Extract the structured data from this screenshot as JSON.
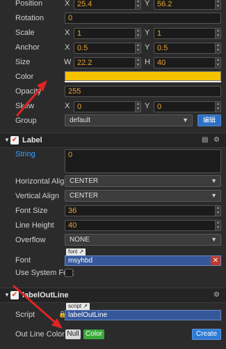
{
  "node": {
    "position": {
      "label": "Position",
      "x_axis": "X",
      "x": "25.4",
      "y_axis": "Y",
      "y": "56.2"
    },
    "rotation": {
      "label": "Rotation",
      "value": "0"
    },
    "scale": {
      "label": "Scale",
      "x_axis": "X",
      "x": "1",
      "y_axis": "Y",
      "y": "1"
    },
    "anchor": {
      "label": "Anchor",
      "x_axis": "X",
      "x": "0.5",
      "y_axis": "Y",
      "y": "0.5"
    },
    "size": {
      "label": "Size",
      "w_axis": "W",
      "w": "22.2",
      "h_axis": "H",
      "h": "40"
    },
    "color": {
      "label": "Color",
      "value": "#f5c400"
    },
    "opacity": {
      "label": "Opacity",
      "value": "255"
    },
    "skew": {
      "label": "Skew",
      "x_axis": "X",
      "x": "0",
      "y_axis": "Y",
      "y": "0"
    },
    "group": {
      "label": "Group",
      "value": "default",
      "edit_button": "编辑"
    }
  },
  "label": {
    "title": "Label",
    "string": {
      "label": "String",
      "value": "0"
    },
    "horizontal_align": {
      "label": "Horizontal Align",
      "value": "CENTER"
    },
    "vertical_align": {
      "label": "Vertical Align",
      "value": "CENTER"
    },
    "font_size": {
      "label": "Font Size",
      "value": "36"
    },
    "line_height": {
      "label": "Line Height",
      "value": "40"
    },
    "overflow": {
      "label": "Overflow",
      "value": "NONE"
    },
    "font": {
      "label": "Font",
      "tag": "font",
      "value": "msyhbd"
    },
    "use_system_font": {
      "label": "Use System Font"
    }
  },
  "outline": {
    "title": "labelOutLine",
    "script": {
      "label": "Script",
      "tag": "script",
      "value": "labelOutLine"
    },
    "out_line_color": {
      "label": "Out Line Color",
      "null_button": "Null",
      "color_button": "Color"
    },
    "create_button": "Create"
  },
  "colors": {
    "accent_blue": "#3aa0ff",
    "swatch": "#f5c400",
    "arrow": "#e02424",
    "create": "#2e7bd6"
  },
  "icons": {
    "collapse": "triangle-down-icon",
    "checkbox": "check-icon",
    "book": "book-icon",
    "gear": "gear-icon",
    "lock": "lock-icon",
    "remove": "close-icon"
  }
}
